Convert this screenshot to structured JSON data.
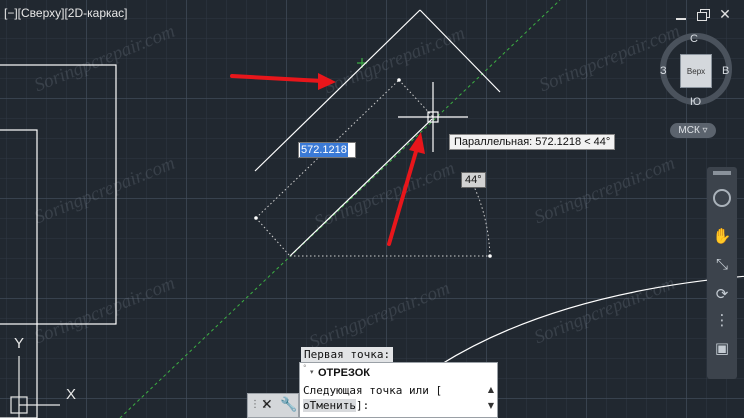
{
  "viewport": {
    "label": "[−][Сверху][2D-каркас]"
  },
  "window_controls": [
    {
      "name": "minimize-icon"
    },
    {
      "name": "restore-icon"
    },
    {
      "name": "close-icon"
    }
  ],
  "viewcube": {
    "face": "Верх",
    "north": "С",
    "south": "Ю",
    "west": "З",
    "east": "В",
    "ucs_menu": "МСК ▿"
  },
  "navigation_bar": {
    "items": [
      "steering-wheel-icon",
      "pan-icon",
      "zoom-extents-icon",
      "orbit-icon",
      "showmotion-icon"
    ]
  },
  "dynamic_input": {
    "distance_value": "572.1218",
    "tooltip": "Параллельная: 572.1218 < 44°",
    "angle": "44°"
  },
  "command_line": {
    "prompt": "Первая точка:",
    "history_command": "ОТРЕЗОК",
    "line1": "Следующая точка или [",
    "option": "оТменить",
    "line2_suffix": "]:"
  },
  "ucs_icon": {
    "y_label": "Y",
    "x_label": "X"
  },
  "colors": {
    "background": "#212830",
    "arrow": "#e8161b",
    "alignment_line": "#3cb043",
    "selection_highlight": "#3b7ad6"
  },
  "watermark": {
    "text": "Soringpcrepair.com"
  }
}
